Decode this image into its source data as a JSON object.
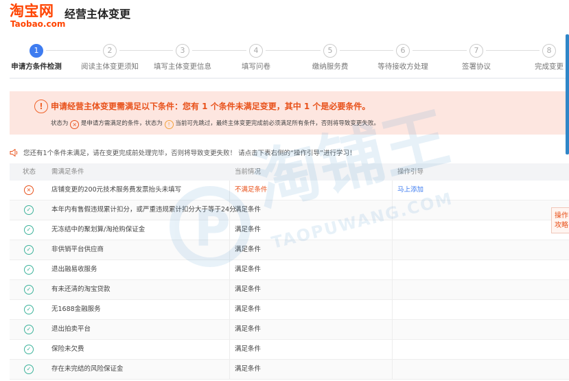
{
  "header": {
    "logo_text": "淘宝网",
    "logo_subtext": "Taobao.com",
    "title": "经营主体变更"
  },
  "steps": [
    {
      "num": "1",
      "label": "申请方条件检测",
      "active": true
    },
    {
      "num": "2",
      "label": "阅读主体变更须知",
      "active": false
    },
    {
      "num": "3",
      "label": "填写主体变更信息",
      "active": false
    },
    {
      "num": "4",
      "label": "填写问卷",
      "active": false
    },
    {
      "num": "5",
      "label": "缴纳服务费",
      "active": false
    },
    {
      "num": "6",
      "label": "等待接收方处理",
      "active": false
    },
    {
      "num": "7",
      "label": "签署协议",
      "active": false
    },
    {
      "num": "8",
      "label": "完成变更",
      "active": false
    }
  ],
  "alert": {
    "title": "申请经营主体变更需满足以下条件：您有 1 个条件未满足变更，其中 1 个是必要条件。",
    "legend_prefix": "状态为",
    "legend_required": "是申请方需满足的条件，状态为",
    "legend_optional": "当前可先跳过，最终主体变更完成前必须满足所有条件，否则将导致变更失败。"
  },
  "notice": "您还有1个条件未满足，请在变更完成前处理完毕，否则将导致变更失败！ 请点击下表右侧的“操作引导”进行学习！",
  "table": {
    "headers": {
      "status": "状态",
      "requirement": "需满足条件",
      "current": "当前情况",
      "guide": "操作引导"
    },
    "rows": [
      {
        "status": "fail",
        "requirement": "店铺变更的200元技术服务费发票抬头未填写",
        "current": "不满足条件",
        "guide": "马上添加"
      },
      {
        "status": "ok",
        "requirement": "本年内有售假违规累计扣分，或严重违规累计扣分大于等于24分",
        "current": "满足条件",
        "guide": ""
      },
      {
        "status": "ok",
        "requirement": "无冻结中的聚划算/淘抢购保证金",
        "current": "满足条件",
        "guide": ""
      },
      {
        "status": "ok",
        "requirement": "非供销平台供应商",
        "current": "满足条件",
        "guide": ""
      },
      {
        "status": "ok",
        "requirement": "退出融易收服务",
        "current": "满足条件",
        "guide": ""
      },
      {
        "status": "ok",
        "requirement": "有未还清的淘宝贷款",
        "current": "满足条件",
        "guide": ""
      },
      {
        "status": "ok",
        "requirement": "无1688金融服务",
        "current": "满足条件",
        "guide": ""
      },
      {
        "status": "ok",
        "requirement": "退出拍卖平台",
        "current": "满足条件",
        "guide": ""
      },
      {
        "status": "ok",
        "requirement": "保险未欠费",
        "current": "满足条件",
        "guide": ""
      },
      {
        "status": "ok",
        "requirement": "存在未完结的风险保证金",
        "current": "满足条件",
        "guide": ""
      }
    ]
  },
  "side_widget": {
    "line1": "操作",
    "line2": "攻略"
  },
  "watermark": {
    "cn": "淘铺王",
    "en": "TAOPUWANG.COM"
  },
  "colors": {
    "brand": "#ff4400",
    "accent": "#3e7cf0",
    "warn": "#e8511a",
    "ok": "#3cb29a",
    "alert_bg": "#fde6e0"
  }
}
